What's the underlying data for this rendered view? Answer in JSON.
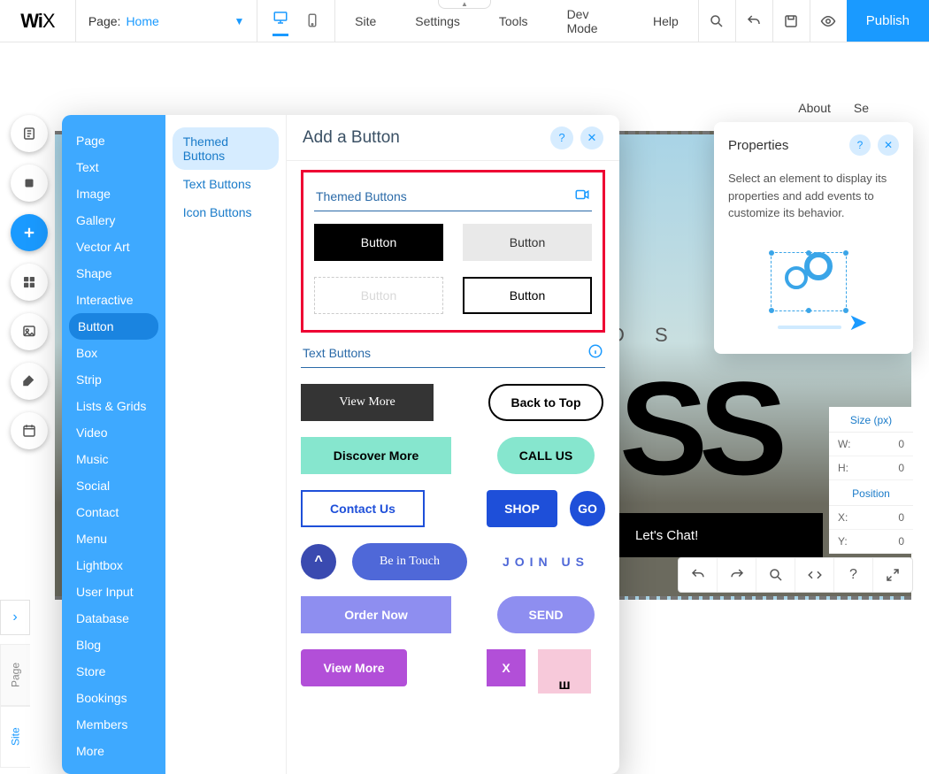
{
  "topbar": {
    "logo": "WiX",
    "page_label": "Page:",
    "page_name": "Home",
    "menus": [
      "Site",
      "Settings",
      "Tools",
      "Dev Mode",
      "Help"
    ],
    "publish": "Publish"
  },
  "rail_tooltips": [
    "Menus & Pages",
    "Background",
    "Add",
    "App Market",
    "Media",
    "Blog",
    "Bookings"
  ],
  "canvas": {
    "nav": [
      "About",
      "Se"
    ],
    "rds": "R D S",
    "big": "SS",
    "chat": "Let's Chat!"
  },
  "addpanel": {
    "title": "Add a Button",
    "col1": [
      "Page",
      "Text",
      "Image",
      "Gallery",
      "Vector Art",
      "Shape",
      "Interactive",
      "Button",
      "Box",
      "Strip",
      "Lists & Grids",
      "Video",
      "Music",
      "Social",
      "Contact",
      "Menu",
      "Lightbox",
      "User Input",
      "Database",
      "Blog",
      "Store",
      "Bookings",
      "Members",
      "More"
    ],
    "col1_selected": "Button",
    "col2": [
      "Themed Buttons",
      "Text Buttons",
      "Icon Buttons"
    ],
    "col2_selected": "Themed Buttons",
    "sections": {
      "themed": {
        "title": "Themed Buttons",
        "samples": [
          "Button",
          "Button",
          "Button",
          "Button"
        ]
      },
      "text": {
        "title": "Text Buttons",
        "samples": [
          "View More",
          "Back to Top",
          "Discover More",
          "CALL US",
          "Contact Us",
          "SHOP",
          "GO",
          "^",
          "Be in Touch",
          "JOIN US",
          "Order Now",
          "SEND",
          "View More",
          "X"
        ]
      }
    }
  },
  "properties": {
    "title": "Properties",
    "msg": "Select an element to display its properties and add events to customize its behavior."
  },
  "inspector": {
    "size_h": "Size (px)",
    "pos_h": "Position",
    "rows": [
      [
        "W:",
        "0"
      ],
      [
        "H:",
        "0"
      ],
      [
        "X:",
        "0"
      ],
      [
        "Y:",
        "0"
      ]
    ]
  },
  "sidetabs": [
    "Page",
    "Site"
  ],
  "btool_tips": [
    "Undo",
    "Redo",
    "Search",
    "Code",
    "Help",
    "Expand"
  ]
}
